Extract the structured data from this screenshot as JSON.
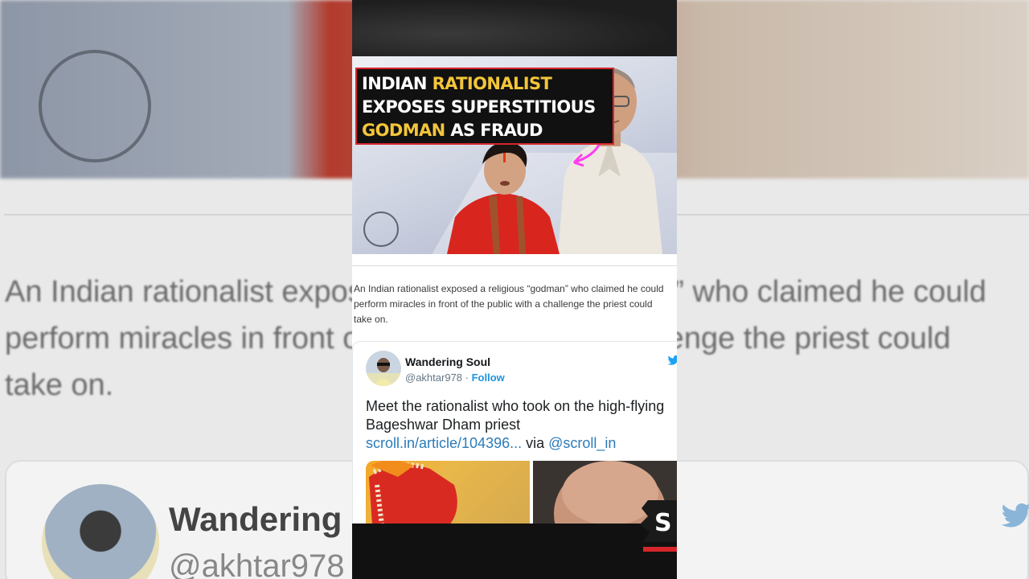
{
  "background": {
    "summary_text": "An Indian rationalist exposed a religious “godman” who claimed he could\nperform miracles in front of the public with a challenge the priest could\ntake on.",
    "user_name": "Wandering Soul",
    "user_handle": "@akhtar978"
  },
  "article": {
    "headline": {
      "line1_prefix": "INDIAN ",
      "line1_highlight": "RATIONALIST",
      "line2": "EXPOSES SUPERSTITIOUS",
      "line3_highlight": "GODMAN",
      "line3_suffix": " AS FRAUD"
    },
    "summary": {
      "line1": "An Indian rationalist exposed a religious “godman” who claimed he could",
      "line2": "perform miracles in front of the public with a challenge the priest could",
      "line3": "take on."
    }
  },
  "tweet": {
    "user_name": "Wandering Soul",
    "user_handle": "@akhtar978",
    "separator": " · ",
    "follow_label": "Follow",
    "text_line": "Meet the rationalist who took on the high-flying Bageshwar Dham priest",
    "link_text": "scroll.in/article/104396...",
    "via_text": " via ",
    "mention_text": "@scroll_in"
  },
  "overlay": {
    "badge_letter": "S"
  },
  "colors": {
    "headline_yellow": "#f3c53a",
    "headline_border": "#d7262b",
    "twitter_blue": "#1b95e0",
    "link_blue": "#2b7bb9"
  },
  "icons": [
    "twitter-bird-icon",
    "site-logo-icon",
    "pink-arrow-icon"
  ]
}
